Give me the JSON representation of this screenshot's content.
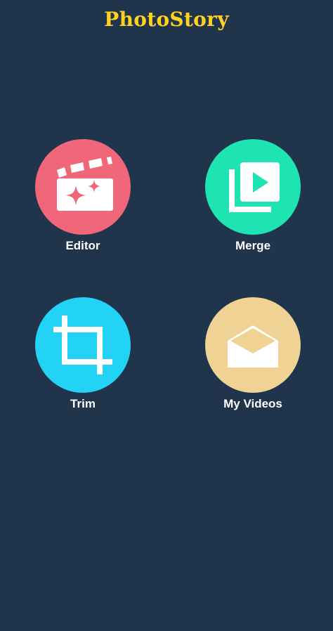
{
  "header": {
    "title": "PhotoStory",
    "title_color": "#ffd21f"
  },
  "background_color": "#20344c",
  "tiles": [
    {
      "label": "Editor",
      "icon": "clapperboard-sparkle-icon",
      "color": "#f1677a"
    },
    {
      "label": "Merge",
      "icon": "stacked-play-icon",
      "color": "#1de4b2"
    },
    {
      "label": "Trim",
      "icon": "crop-icon",
      "color": "#23d3f5"
    },
    {
      "label": "My Videos",
      "icon": "open-envelope-icon",
      "color": "#f0d295"
    }
  ]
}
